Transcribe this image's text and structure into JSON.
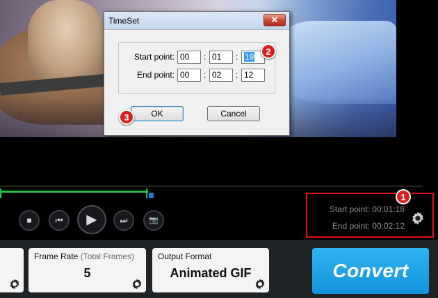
{
  "dialog": {
    "title": "TimeSet",
    "close_glyph": "✕",
    "start_label": "Start point:",
    "end_label": "End point:",
    "start": [
      "00",
      "01",
      "19"
    ],
    "end": [
      "00",
      "02",
      "12"
    ],
    "colon": ":",
    "ok_label": "OK",
    "cancel_label": "Cancel"
  },
  "player": {
    "progress_fraction": 0.35,
    "controls": [
      {
        "name": "stop-icon",
        "glyph": "■"
      },
      {
        "name": "previous-icon",
        "glyph": "⏮"
      },
      {
        "name": "play-icon",
        "glyph": "▶"
      },
      {
        "name": "next-icon",
        "glyph": "⏭"
      },
      {
        "name": "snapshot-icon",
        "glyph": "📷"
      }
    ],
    "start_point_text": "Start point: 00:01:18",
    "end_point_text": "End point: 00:02:12"
  },
  "annotations": {
    "badge_1": "1",
    "badge_2": "2",
    "badge_3": "3",
    "color": "#d81e1e"
  },
  "settings": {
    "frame_rate_label": "Frame Rate",
    "frame_rate_sub": "(Total Frames)",
    "frame_rate_value": "5",
    "output_label": "Output Format",
    "output_value": "Animated GIF",
    "gear_icon": "gear-icon"
  },
  "convert_label": "Convert",
  "colors": {
    "accent": "#1e9be6",
    "progress": "#22c04a",
    "highlight": "#e01010"
  }
}
